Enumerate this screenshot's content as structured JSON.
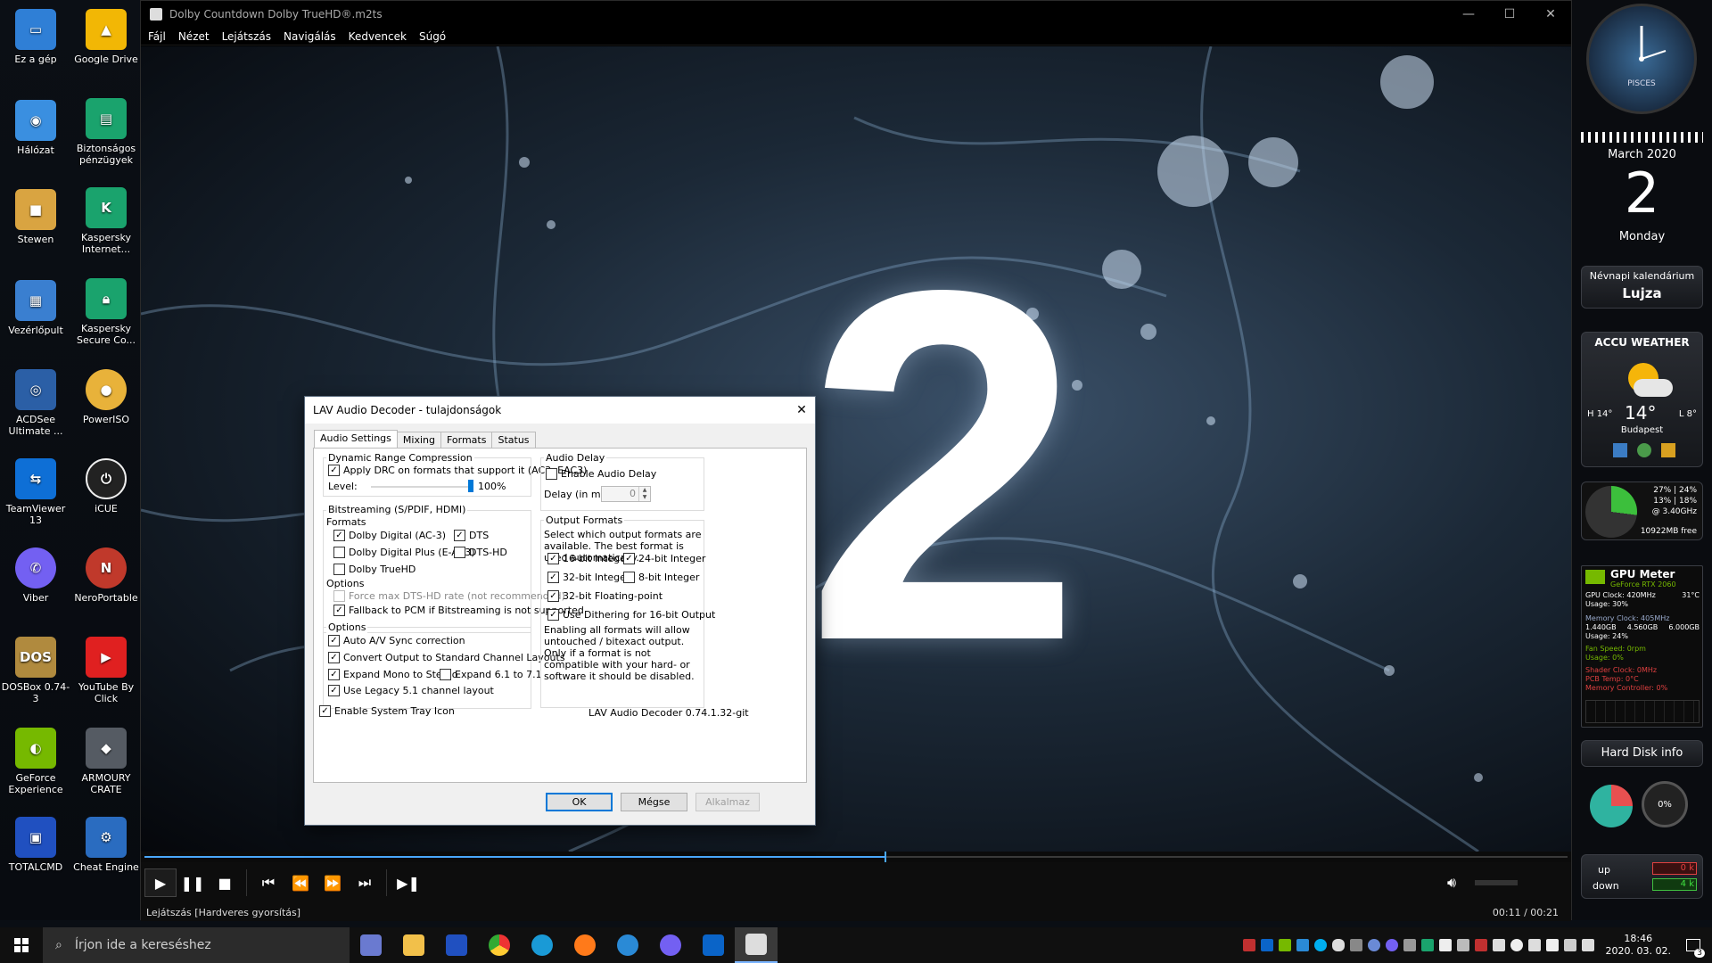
{
  "desktop": {
    "icons": [
      {
        "label": "Ez a gép",
        "color": "#2f7fd6"
      },
      {
        "label": "Google Drive",
        "color": "#f2b705"
      },
      {
        "label": "Hálózat",
        "color": "#3a8fe0"
      },
      {
        "label": "Biztonságos pénzügyek",
        "color": "#1aa36d"
      },
      {
        "label": "Stewen",
        "color": "#d9a441"
      },
      {
        "label": "Kaspersky Internet...",
        "color": "#1aa36d"
      },
      {
        "label": "Vezérlőpult",
        "color": "#3a7fd0"
      },
      {
        "label": "Kaspersky Secure Co...",
        "color": "#1aa36d"
      },
      {
        "label": "ACDSee Ultimate ...",
        "color": "#2b5fa6"
      },
      {
        "label": "PowerISO",
        "color": "#e8b23a"
      },
      {
        "label": "TeamViewer 13",
        "color": "#0e6fd6"
      },
      {
        "label": "iCUE",
        "color": "#222222"
      },
      {
        "label": "Viber",
        "color": "#7360f2"
      },
      {
        "label": "NeroPortable",
        "color": "#c0392b"
      },
      {
        "label": "DOSBox 0.74-3",
        "color": "#b08a3e"
      },
      {
        "label": "YouTube By Click",
        "color": "#e02020"
      },
      {
        "label": "GeForce Experience",
        "color": "#76b900"
      },
      {
        "label": "ARMOURY CRATE",
        "color": "#555b63"
      },
      {
        "label": "TOTALCMD",
        "color": "#2050c0"
      },
      {
        "label": "Cheat Engine",
        "color": "#2a6cc0"
      }
    ]
  },
  "player": {
    "title": "Dolby Countdown Dolby TrueHD®.m2ts",
    "menu": [
      "Fájl",
      "Nézet",
      "Lejátszás",
      "Navigálás",
      "Kedvencek",
      "Súgó"
    ],
    "video_text": "2",
    "progress": 0.52,
    "status_left": "Lejátszás [Hardveres gyorsítás]",
    "time": "00:11 / 00:21"
  },
  "dialog": {
    "title": "LAV Audio Decoder - tulajdonságok",
    "tabs": [
      "Audio Settings",
      "Mixing",
      "Formats",
      "Status"
    ],
    "drc_group": "Dynamic Range Compression",
    "drc_check": "Apply DRC on formats that support it (AC3, EAC3)",
    "level_label": "Level:",
    "level_value": "100%",
    "level_fraction": 1.0,
    "bitstream_group": "Bitstreaming (S/PDIF, HDMI)",
    "formats_label": "Formats",
    "bs_ac3": "Dolby Digital (AC-3)",
    "bs_dts": "DTS",
    "bs_eac3": "Dolby Digital Plus (E-AC3)",
    "bs_dtshd": "DTS-HD",
    "bs_truehd": "Dolby TrueHD",
    "bs_options_label": "Options",
    "bs_forcedts": "Force max DTS-HD rate (not recommended)",
    "bs_fallback": "Fallback to PCM if Bitstreaming is not supported",
    "options_group": "Options",
    "opt_avsync": "Auto A/V Sync correction",
    "opt_convert": "Convert Output to Standard Channel Layouts",
    "opt_expandmono": "Expand Mono to Stereo",
    "opt_expand61": "Expand 6.1 to 7.1",
    "opt_legacy": "Use Legacy 5.1 channel layout",
    "tray_icon": "Enable System Tray Icon",
    "delay_group": "Audio Delay",
    "delay_enable": "Enable Audio Delay",
    "delay_label": "Delay (in ms):",
    "delay_value": "0",
    "outfmt_group": "Output Formats",
    "outfmt_desc": "Select which output formats are available. The best format is used automatically.",
    "fmt_16": "16-bit Integer",
    "fmt_24": "24-bit Integer",
    "fmt_32": "32-bit Integer",
    "fmt_8": "8-bit Integer",
    "fmt_float": "32-bit Floating-point",
    "dither": "Use Dithering for 16-bit Output",
    "outfmt_note": "Enabling all formats will allow untouched / bitexact output. Only if a format is not compatible with your hard- or software it should be disabled.",
    "version": "LAV Audio Decoder 0.74.1.32-git",
    "btn_ok": "OK",
    "btn_cancel": "Mégse",
    "btn_apply": "Alkalmaz"
  },
  "gadgets": {
    "clock_label": "PISCES",
    "month": "March 2020",
    "day": "2",
    "weekday": "Monday",
    "nameday_title": "Névnapi kalendárium",
    "nameday": "Lujza",
    "weather_title": "ACCU WEATHER",
    "temp": "14°",
    "high": "H 14°",
    "low": "L 8°",
    "city": "Budapest",
    "cpu_line1": "27% | 24%",
    "cpu_line2": "13% | 18%",
    "cpu_freq": "@ 3.40GHz",
    "cpu_free": "10922MB free",
    "gpu_title": "GPU Meter",
    "gpu_name": "GeForce RTX 2060",
    "gpu_clock": "GPU Clock: 420MHz",
    "gpu_temp": "31°C",
    "gpu_usage": "Usage: 30%",
    "mem_clock": "Memory Clock: 405MHz",
    "mem_used": "1.440GB",
    "mem_free": "4.560GB",
    "mem_total": "6.000GB",
    "mem_usage": "Usage: 24%",
    "fan": "Fan Speed: 0rpm",
    "fan_usage": "Usage: 0%",
    "shader": "Shader Clock: 0MHz",
    "pcb": "PCB Temp: 0°C",
    "memctrl": "Memory Controller: 0%",
    "hdd_title": "Hard Disk info",
    "hdd_pct": "0%",
    "net_up": "up",
    "net_down": "down",
    "net_up_val": "0 k",
    "net_down_val": "4 k"
  },
  "taskbar": {
    "search_placeholder": "Írjon ide a kereséshez",
    "time": "18:46",
    "date": "2020. 03. 02.",
    "notif_count": "3"
  }
}
